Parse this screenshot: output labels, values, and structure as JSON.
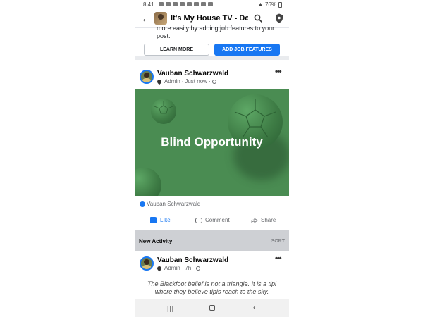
{
  "status_bar": {
    "time": "8:41",
    "battery": "76%"
  },
  "header": {
    "title": "It's My House TV - Do..."
  },
  "job_card": {
    "text": "more easily by adding job features to your post.",
    "learn_more": "LEARN MORE",
    "add_job_features": "ADD JOB FEATURES"
  },
  "post": {
    "author": "Vauban Schwarzwald",
    "role": "Admin",
    "time": "Just now",
    "image_caption": "Blind Opportunity",
    "reaction_name": "Vauban Schwarzwald",
    "actions": {
      "like": "Like",
      "comment": "Comment",
      "share": "Share"
    }
  },
  "section": {
    "title": "New Activity",
    "sort": "SORT"
  },
  "post2": {
    "author": "Vauban Schwarzwald",
    "role": "Admin",
    "time": "7h",
    "text": "The Blackfoot belief is not a triangle. It is a tipi where they believe tipis reach to the sky."
  },
  "colors": {
    "accent": "#1877f2",
    "image_background": "#4a8c52",
    "section_background": "#ced0d4"
  },
  "icons": [
    "back-arrow-icon",
    "search-icon",
    "shield-icon",
    "more-icon",
    "pin-icon",
    "globe-icon",
    "like-icon",
    "comment-icon",
    "share-icon"
  ]
}
